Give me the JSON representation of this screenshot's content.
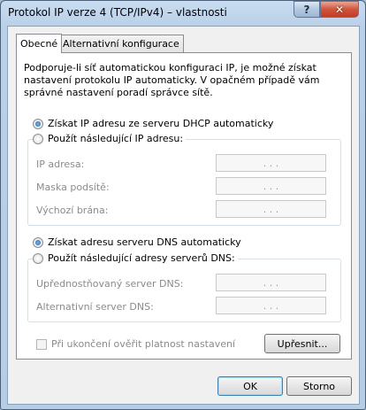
{
  "window": {
    "title": "Protokol IP verze 4 (TCP/IPv4) – vlastnosti",
    "help_glyph": "?",
    "close_glyph": "✕"
  },
  "tabs": [
    {
      "label": "Obecné",
      "active": true
    },
    {
      "label": "Alternativní konfigurace",
      "active": false
    }
  ],
  "general": {
    "intro": "Podporuje-li síť automatickou konfiguraci IP, je možné získat nastavení protokolu IP automaticky. V opačném případě vám správné nastavení poradí správce sítě.",
    "ip": {
      "auto_label": "Získat IP adresu ze serveru DHCP automaticky",
      "manual_label": "Použít následující IP adresu:",
      "selected": "auto",
      "fields": [
        {
          "label": "IP adresa:",
          "value": ". . ."
        },
        {
          "label": "Maska podsítě:",
          "value": ". . ."
        },
        {
          "label": "Výchozí brána:",
          "value": ". . ."
        }
      ]
    },
    "dns": {
      "auto_label": "Získat adresu serveru DNS automaticky",
      "manual_label": "Použít následující adresy serverů DNS:",
      "selected": "auto",
      "fields": [
        {
          "label": "Upřednostňovaný server DNS:",
          "value": ". . ."
        },
        {
          "label": "Alternativní server DNS:",
          "value": ". . ."
        }
      ]
    },
    "validate_label": "Při ukončení ověřit platnost nastavení",
    "validate_checked": false,
    "advanced_button": "Upřesnit..."
  },
  "footer": {
    "ok": "OK",
    "cancel": "Storno"
  }
}
